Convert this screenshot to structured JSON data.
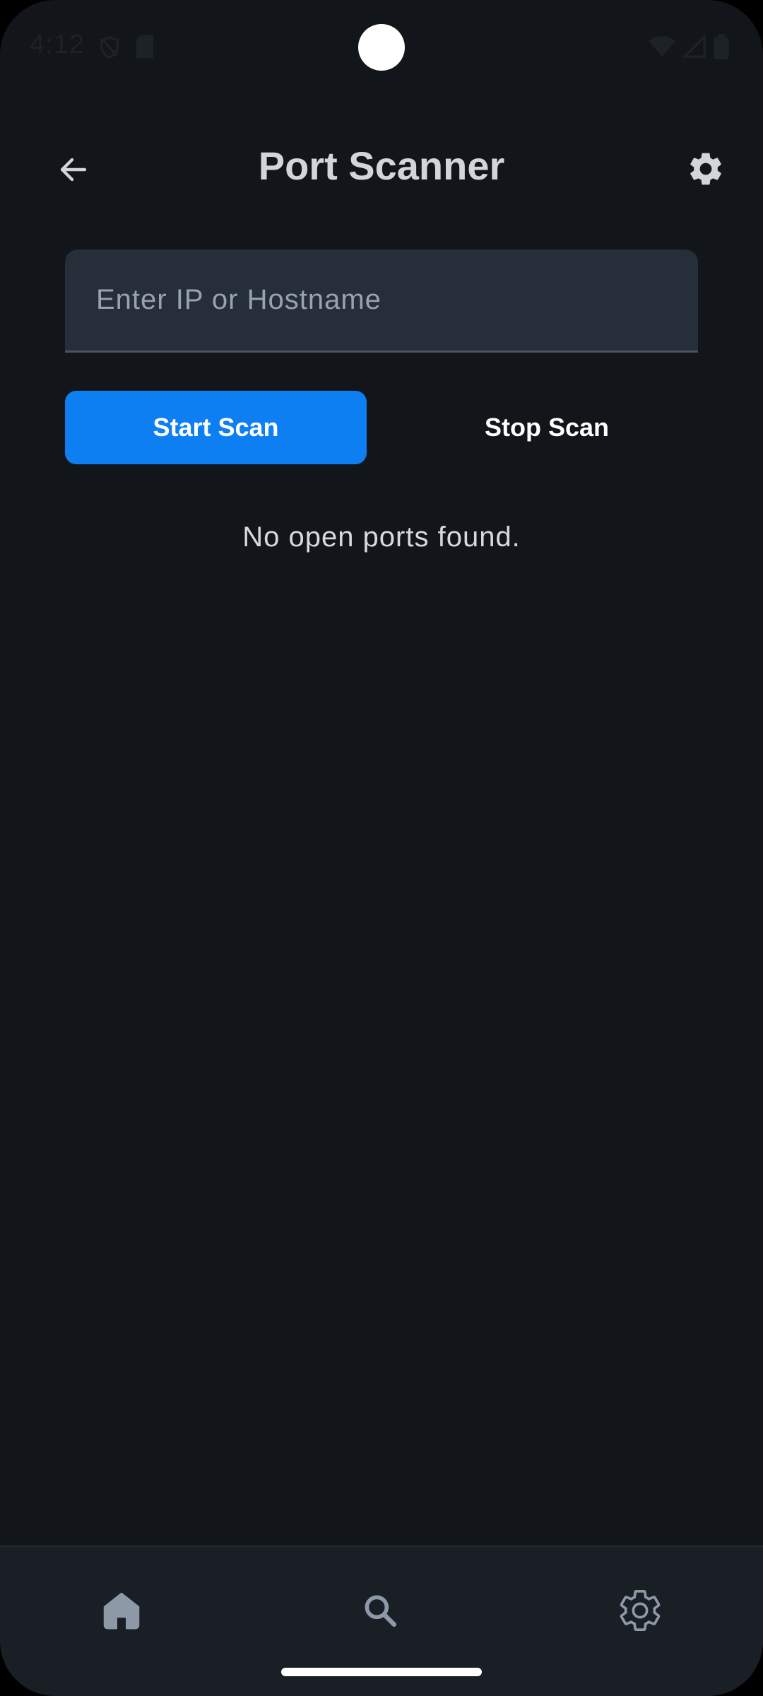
{
  "status_bar": {
    "time": "4:12",
    "left_icons": [
      "shield-icon",
      "sd-card-icon"
    ],
    "right_icons": [
      "wifi-icon",
      "signal-icon",
      "battery-icon"
    ]
  },
  "app_bar": {
    "title": "Port Scanner",
    "back_icon": "arrow-left-icon",
    "settings_icon": "gear-icon"
  },
  "host_input": {
    "placeholder": "Enter IP or Hostname",
    "value": ""
  },
  "actions": {
    "start_label": "Start Scan",
    "stop_label": "Stop Scan"
  },
  "results": {
    "empty_text": "No open ports found."
  },
  "bottom_nav": {
    "items": [
      {
        "icon": "home-icon",
        "active": true
      },
      {
        "icon": "search-icon",
        "active": false
      },
      {
        "icon": "settings-outline-icon",
        "active": false
      }
    ]
  },
  "colors": {
    "background": "#12151a",
    "accent": "#0e7ff2",
    "input_bg": "#262e39",
    "nav_bg": "#1a1e25",
    "title": "#d2d6dc",
    "nav_icon": "#8e99a8"
  }
}
